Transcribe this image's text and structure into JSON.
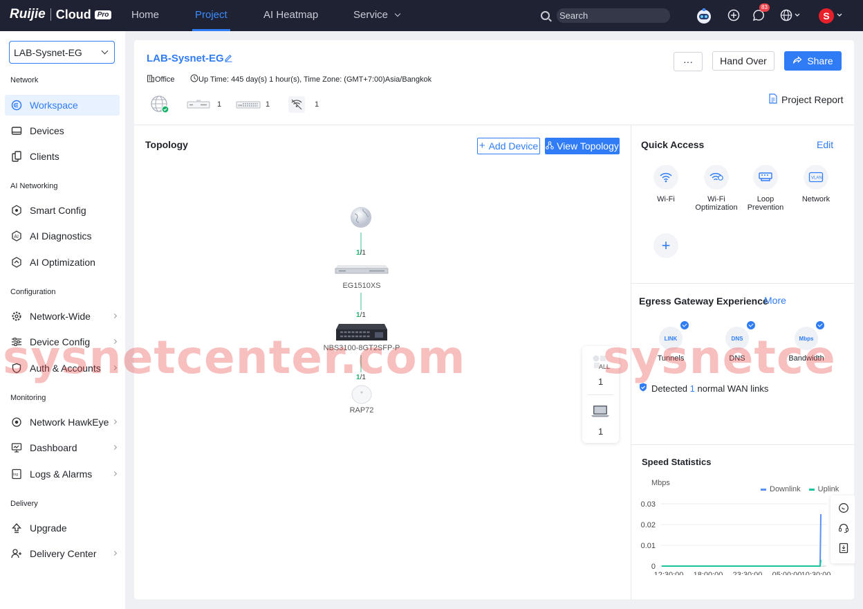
{
  "brand": {
    "logo": "Ruijie",
    "cloud": "Cloud",
    "pro": "Pro"
  },
  "nav": {
    "home": "Home",
    "project": "Project",
    "heatmap": "AI Heatmap",
    "service": "Service"
  },
  "search": {
    "placeholder": "Search"
  },
  "topbar": {
    "messages_badge": "83",
    "user_initial": "S"
  },
  "sidebar": {
    "project_selector": "LAB-Sysnet-EG",
    "sections": {
      "network": "Network",
      "ai_networking": "AI Networking",
      "configuration": "Configuration",
      "monitoring": "Monitoring",
      "delivery": "Delivery"
    },
    "items": {
      "workspace": "Workspace",
      "devices": "Devices",
      "clients": "Clients",
      "smart_config": "Smart Config",
      "ai_diagnostics": "AI Diagnostics",
      "ai_optimization": "AI Optimization",
      "network_wide": "Network-Wide",
      "device_config": "Device Config",
      "auth_accounts": "Auth & Accounts",
      "network_hawkeye": "Network HawkEye",
      "dashboard": "Dashboard",
      "logs_alarms": "Logs & Alarms",
      "upgrade": "Upgrade",
      "delivery_center": "Delivery Center"
    }
  },
  "project": {
    "name": "LAB-Sysnet-EG",
    "scenario": "Office",
    "uptime": "Up Time: 445 day(s) 1 hour(s), Time Zone: (GMT+7:00)Asia/Bangkok",
    "device_counts": {
      "gateway": "1",
      "switch": "1",
      "ap": "1"
    },
    "more_label": "···",
    "handover_label": "Hand Over",
    "share_label": "Share",
    "report_label": "Project Report"
  },
  "topology": {
    "title": "Topology",
    "add_device": "Add Device",
    "view_topology": "View Topology",
    "nodes": {
      "gateway": "EG1510XS",
      "switch": "NBS3100-8GT2SFP-P",
      "ap": "RAP72"
    },
    "links": [
      "1",
      "/1",
      "1",
      "/1",
      "1",
      "/1"
    ],
    "filter": {
      "all_label": "ALL",
      "all_count": "1",
      "laptop_count": "1"
    }
  },
  "quick_access": {
    "title": "Quick Access",
    "edit": "Edit",
    "items": [
      "Wi-Fi",
      "Wi-Fi Optimization",
      "Loop Prevention",
      "Network"
    ]
  },
  "egress": {
    "title": "Egress Gateway Experience",
    "more": "More",
    "items": [
      "Tunnels",
      "DNS",
      "Bandwidth"
    ],
    "icons": [
      "LINK",
      "DNS",
      "Mbps"
    ],
    "detected_pre": "Detected ",
    "detected_count": "1",
    "detected_post": " normal WAN links"
  },
  "speed": {
    "title": "Speed Statistics",
    "unit": "Mbps",
    "legend": [
      "Downlink",
      "Uplink"
    ]
  },
  "chart_data": {
    "type": "line",
    "title": "Speed Statistics",
    "ylabel": "Mbps",
    "x": [
      "12:30:00",
      "18:00:00",
      "23:30:00",
      "05:00:00",
      "10:30:00"
    ],
    "yticks": [
      "0.03",
      "0.02",
      "0.01",
      "0"
    ],
    "ylim": [
      0,
      0.03
    ],
    "series": [
      {
        "name": "Downlink",
        "color": "#5b8ff9",
        "values": [
          0,
          0,
          0,
          0,
          0.025
        ]
      },
      {
        "name": "Uplink",
        "color": "#19c39b",
        "values": [
          0,
          0,
          0,
          0,
          0.003
        ]
      }
    ]
  },
  "watermark": "sysnetcenter.com",
  "watermark2": "sysnetce",
  "colors": {
    "accent": "#2f7cf6",
    "topbar": "#1f2233",
    "link": "#17b26a"
  }
}
